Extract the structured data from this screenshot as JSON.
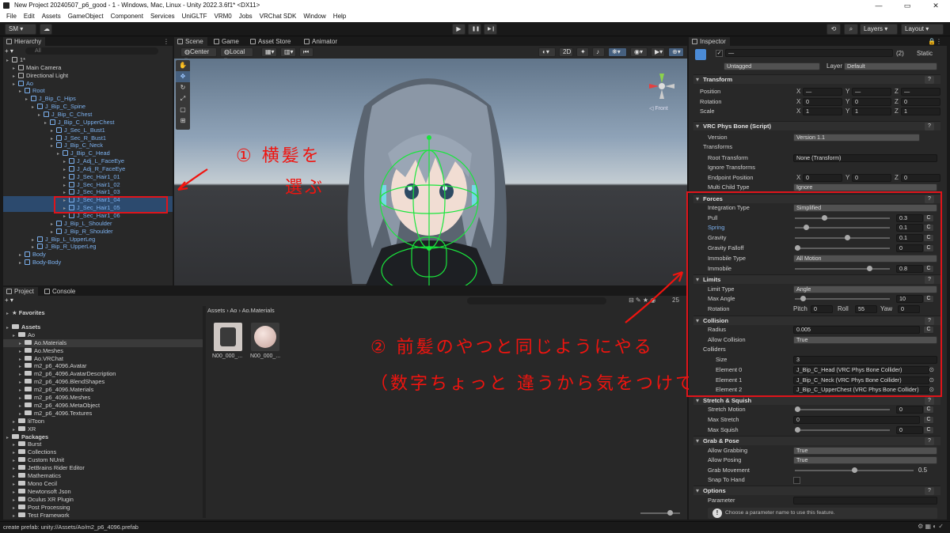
{
  "window": {
    "title": "New Project 20240507_p6_good - 1 - Windows, Mac, Linux - Unity 2022.3.6f1* <DX11>",
    "controls": [
      "—",
      "▭",
      "✕"
    ]
  },
  "menu": [
    "File",
    "Edit",
    "Assets",
    "GameObject",
    "Component",
    "Services",
    "UniGLTF",
    "VRM0",
    "Jobs",
    "VRChat SDK",
    "Window",
    "Help"
  ],
  "toolbar": {
    "account": "SM ▾",
    "cloud": "☁",
    "play": "▶",
    "pause": "❚❚",
    "step": "▶❙",
    "history": "⟲",
    "search": "⌕",
    "layers": "Layers",
    "layout": "Layout"
  },
  "hierarchy": {
    "tab": "Hierarchy",
    "search_placeholder": "All",
    "add": "+ ▾",
    "items": [
      {
        "label": "1*",
        "depth": 0,
        "type": "scene"
      },
      {
        "label": "Main Camera",
        "depth": 1
      },
      {
        "label": "Directional Light",
        "depth": 1
      },
      {
        "label": "Ao",
        "depth": 1,
        "blue": true
      },
      {
        "label": "Root",
        "depth": 2,
        "blue": true
      },
      {
        "label": "J_Bip_C_Hips",
        "depth": 3,
        "blue": true
      },
      {
        "label": "J_Bip_C_Spine",
        "depth": 4,
        "blue": true
      },
      {
        "label": "J_Bip_C_Chest",
        "depth": 5,
        "blue": true
      },
      {
        "label": "J_Bip_C_UpperChest",
        "depth": 6,
        "blue": true
      },
      {
        "label": "J_Sec_L_Bust1",
        "depth": 7,
        "blue": true
      },
      {
        "label": "J_Sec_R_Bust1",
        "depth": 7,
        "blue": true
      },
      {
        "label": "J_Bip_C_Neck",
        "depth": 7,
        "blue": true
      },
      {
        "label": "J_Bip_C_Head",
        "depth": 8,
        "blue": true
      },
      {
        "label": "J_Adj_L_FaceEye",
        "depth": 9,
        "blue": true
      },
      {
        "label": "J_Adj_R_FaceEye",
        "depth": 9,
        "blue": true
      },
      {
        "label": "J_Sec_Hair1_01",
        "depth": 9,
        "blue": true
      },
      {
        "label": "J_Sec_Hair1_02",
        "depth": 9,
        "blue": true
      },
      {
        "label": "J_Sec_Hair1_03",
        "depth": 9,
        "blue": true
      },
      {
        "label": "J_Sec_Hair1_04",
        "depth": 9,
        "blue": true,
        "selected": true
      },
      {
        "label": "J_Sec_Hair1_05",
        "depth": 9,
        "blue": true,
        "selected": true
      },
      {
        "label": "J_Sec_Hair1_06",
        "depth": 9,
        "blue": true
      },
      {
        "label": "J_Bip_L_Shoulder",
        "depth": 7,
        "blue": true
      },
      {
        "label": "J_Bip_R_Shoulder",
        "depth": 7,
        "blue": true
      },
      {
        "label": "J_Bip_L_UpperLeg",
        "depth": 4,
        "blue": true
      },
      {
        "label": "J_Bip_R_UpperLeg",
        "depth": 4,
        "blue": true
      },
      {
        "label": "Body",
        "depth": 2,
        "blue": true
      },
      {
        "label": "Body-Body",
        "depth": 2,
        "blue": true
      }
    ]
  },
  "scene": {
    "tabs": [
      "Scene",
      "Game",
      "Asset Store",
      "Animator"
    ],
    "pivot": "Center",
    "space": "Local",
    "mode2d": "2D",
    "front": "◁ Front",
    "annotation1": "① 横髪を",
    "annotation1b": "選ぶ"
  },
  "project": {
    "tabs": [
      "Project",
      "Console"
    ],
    "breadcrumb": [
      "Assets",
      "Ao",
      "Ao.Materials"
    ],
    "count": "25",
    "tree": [
      {
        "label": "Favorites",
        "depth": 0,
        "star": true
      },
      {
        "label": "Assets",
        "depth": 0
      },
      {
        "label": "Ao",
        "depth": 1
      },
      {
        "label": "Ao.Materials",
        "depth": 2,
        "selected": true
      },
      {
        "label": "Ao.Meshes",
        "depth": 2
      },
      {
        "label": "Ao.VRChat",
        "depth": 2
      },
      {
        "label": "m2_p6_4096.Avatar",
        "depth": 2
      },
      {
        "label": "m2_p6_4096.AvatarDescription",
        "depth": 2
      },
      {
        "label": "m2_p6_4096.BlendShapes",
        "depth": 2
      },
      {
        "label": "m2_p6_4096.Materials",
        "depth": 2
      },
      {
        "label": "m2_p6_4096.Meshes",
        "depth": 2
      },
      {
        "label": "m2_p6_4096.MetaObject",
        "depth": 2
      },
      {
        "label": "m2_p6_4096.Textures",
        "depth": 2
      },
      {
        "label": "lilToon",
        "depth": 1
      },
      {
        "label": "XR",
        "depth": 1
      },
      {
        "label": "Packages",
        "depth": 0
      },
      {
        "label": "Burst",
        "depth": 1
      },
      {
        "label": "Collections",
        "depth": 1
      },
      {
        "label": "Custom NUnit",
        "depth": 1
      },
      {
        "label": "JetBrains Rider Editor",
        "depth": 1
      },
      {
        "label": "Mathematics",
        "depth": 1
      },
      {
        "label": "Mono Cecil",
        "depth": 1
      },
      {
        "label": "Newtonsoft Json",
        "depth": 1
      },
      {
        "label": "Oculus XR Plugin",
        "depth": 1
      },
      {
        "label": "Post Processing",
        "depth": 1
      },
      {
        "label": "Test Framework",
        "depth": 1
      }
    ],
    "assets": [
      "N00_000_...",
      "N00_000_..."
    ],
    "annotation2": "② 前髪のやつと同じようにやる",
    "annotation2b": "（数字ちょっと 違うから気をつけて）"
  },
  "inspector": {
    "tab": "Inspector",
    "name": "—",
    "count": "(2)",
    "static": "Static",
    "tag_label": "Tag",
    "tag": "Untagged",
    "layer_label": "Layer",
    "layer": "Default",
    "transform": {
      "title": "Transform",
      "position": "Position",
      "rotation": "Rotation",
      "scale": "Scale",
      "pos": [
        "—",
        "—",
        "—"
      ],
      "rot": [
        "0",
        "0",
        "0"
      ],
      "scl": [
        "1",
        "1",
        "1"
      ]
    },
    "physbone": {
      "title": "VRC Phys Bone (Script)",
      "version_label": "Version",
      "version": "Version 1.1",
      "transforms": "Transforms",
      "root_label": "Root Transform",
      "root": "None (Transform)",
      "ignore": "Ignore Transforms",
      "endpoint_label": "Endpoint Position",
      "endpoint": [
        "0",
        "0",
        "0"
      ],
      "multichild_label": "Multi Child Type",
      "multichild": "Ignore",
      "forces": "Forces",
      "integration_label": "Integration Type",
      "integration": "Simplified",
      "pull_label": "Pull",
      "pull": "0.3",
      "pull_level": 0.3,
      "spring_label": "Spring",
      "spring": "0.1",
      "spring_level": 0.1,
      "gravity_label": "Gravity",
      "gravity": "0.1",
      "gravity_level": 0.55,
      "gravfall_label": "Gravity Falloff",
      "gravfall": "0",
      "gravfall_level": 0,
      "immtype_label": "Immobile Type",
      "immtype": "All Motion",
      "immobile_label": "Immobile",
      "immobile": "0.8",
      "immobile_level": 0.8,
      "limits": "Limits",
      "limittype_label": "Limit Type",
      "limittype": "Angle",
      "maxangle_label": "Max Angle",
      "maxangle": "10",
      "maxangle_level": 0.06,
      "rotation_label": "Rotation",
      "pitch_label": "Pitch",
      "pitch": "0",
      "roll_label": "Roll",
      "roll": "55",
      "yaw_label": "Yaw",
      "yaw": "0",
      "collision": "Collision",
      "radius_label": "Radius",
      "radius": "0.005",
      "allowcol_label": "Allow Collision",
      "allowcol": "True",
      "colliders": "Colliders",
      "size_label": "Size",
      "size": "3",
      "elements": [
        {
          "label": "Element 0",
          "value": "J_Bip_C_Head (VRC Phys Bone Collider)"
        },
        {
          "label": "Element 1",
          "value": "J_Bip_C_Neck (VRC Phys Bone Collider)"
        },
        {
          "label": "Element 2",
          "value": "J_Bip_C_UpperChest (VRC Phys Bone Collider)"
        }
      ],
      "stretch": "Stretch & Squish",
      "stretchmotion_label": "Stretch Motion",
      "stretchmotion": "0",
      "maxstretch_label": "Max Stretch",
      "maxstretch": "0",
      "maxsquish_label": "Max Squish",
      "maxsquish": "0",
      "grab": "Grab & Pose",
      "allowgrab_label": "Allow Grabbing",
      "allowgrab": "True",
      "allowpose_label": "Allow Posing",
      "allowpose": "True",
      "grabmove_label": "Grab Movement",
      "grabmove": "0.5",
      "grabmove_level": 0.5,
      "snap_label": "Snap To Hand",
      "options": "Options",
      "param_label": "Parameter",
      "param_help": "Choose a parameter name to use this feature."
    }
  },
  "statusbar": {
    "text": "create prefab: unity://Assets/Ao/m2_p6_4096.prefab"
  },
  "colors": {
    "accent": "#7cb1ef",
    "annotation": "#f0140f",
    "panel": "#282828"
  }
}
